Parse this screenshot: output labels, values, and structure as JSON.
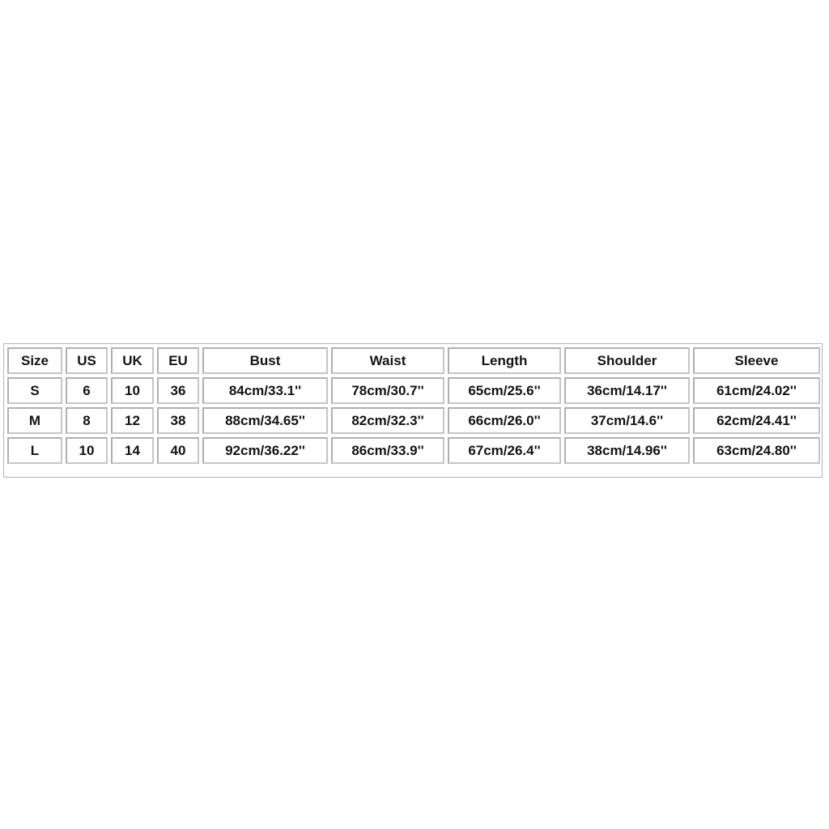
{
  "size_chart": {
    "headers": [
      "Size",
      "US",
      "UK",
      "EU",
      "Bust",
      "Waist",
      "Length",
      "Shoulder",
      "Sleeve"
    ],
    "rows": [
      [
        "S",
        "6",
        "10",
        "36",
        "84cm/33.1''",
        "78cm/30.7''",
        "65cm/25.6''",
        "36cm/14.17''",
        "61cm/24.02''"
      ],
      [
        "M",
        "8",
        "12",
        "38",
        "88cm/34.65''",
        "82cm/32.3''",
        "66cm/26.0''",
        "37cm/14.6''",
        "62cm/24.41''"
      ],
      [
        "L",
        "10",
        "14",
        "40",
        "92cm/36.22''",
        "86cm/33.9''",
        "67cm/26.4''",
        "38cm/14.96''",
        "63cm/24.80''"
      ]
    ]
  }
}
